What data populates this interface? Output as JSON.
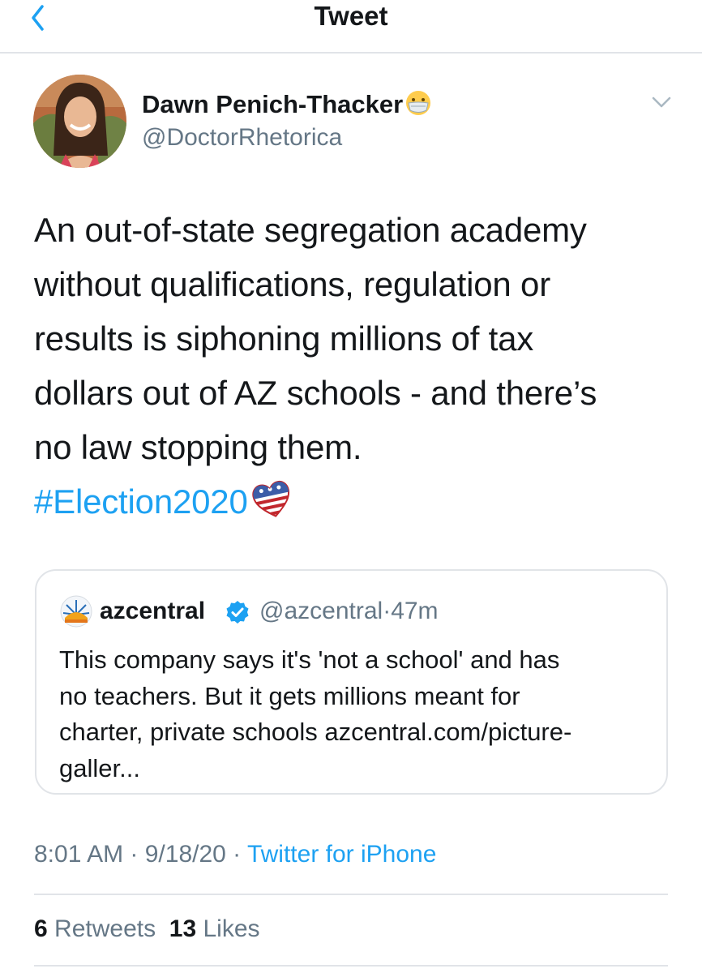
{
  "header": {
    "title": "Tweet",
    "back_icon": "chevron-left-icon"
  },
  "author": {
    "display_name": "Dawn Penich-Thacker",
    "name_emoji": "face-with-medical-mask-emoji",
    "handle": "@DoctorRhetorica"
  },
  "tweet": {
    "text_lines": [
      "An out-of-state segregation academy",
      "without qualifications, regulation or",
      "results is siphoning millions of tax",
      "dollars out of AZ schools - and there’s",
      "no law stopping them."
    ],
    "hashtag": "#Election2020",
    "hashtag_emoji": "ballot-heart-icon"
  },
  "quote": {
    "name": "azcentral",
    "verified": true,
    "handle": "@azcentral",
    "separator": "·",
    "time": "47m",
    "text_lines": [
      "This company says it's 'not a school' and has",
      "no teachers. But it gets millions meant for",
      "charter, private schools azcentral.com/picture-",
      "galler..."
    ]
  },
  "meta": {
    "time": "8:01 AM",
    "sep1": " · ",
    "date": "9/18/20",
    "sep2": " · ",
    "source": "Twitter for iPhone"
  },
  "stats": {
    "retweets_count": "6",
    "retweets_label": "Retweets",
    "likes_count": "13",
    "likes_label": "Likes"
  },
  "colors": {
    "accent": "#1da1f2",
    "text": "#14171a",
    "secondary": "#657786",
    "border": "#e1e4e8"
  }
}
